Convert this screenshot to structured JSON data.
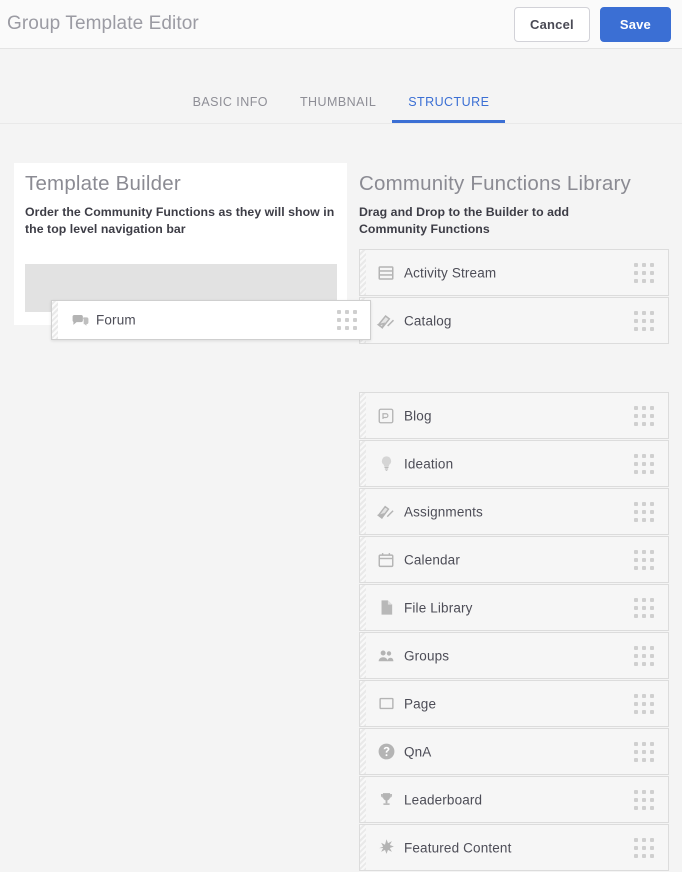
{
  "topbar": {
    "title": "Group Template Editor",
    "cancel_label": "Cancel",
    "save_label": "Save",
    "save_color": "#3b6fd4"
  },
  "tabs": [
    {
      "label": "BASIC INFO",
      "active": false
    },
    {
      "label": "THUMBNAIL",
      "active": false
    },
    {
      "label": "STRUCTURE",
      "active": true
    }
  ],
  "builder": {
    "title": "Template Builder",
    "subtitle": "Order the Community Functions as they will show in the top level navigation bar",
    "placeholder_visible": true
  },
  "library": {
    "title": "Community Functions Library",
    "subtitle": "Drag and Drop to the Builder to add Community Functions",
    "items": [
      {
        "label": "Activity Stream",
        "icon": "activity-stream-icon",
        "gap_after": false
      },
      {
        "label": "Catalog",
        "icon": "catalog-icon",
        "gap_after": true
      },
      {
        "label": "Blog",
        "icon": "blog-icon",
        "gap_after": false
      },
      {
        "label": "Ideation",
        "icon": "lightbulb-icon",
        "gap_after": false
      },
      {
        "label": "Assignments",
        "icon": "assignments-icon",
        "gap_after": false
      },
      {
        "label": "Calendar",
        "icon": "calendar-icon",
        "gap_after": false
      },
      {
        "label": "File Library",
        "icon": "file-icon",
        "gap_after": false
      },
      {
        "label": "Groups",
        "icon": "groups-icon",
        "gap_after": false
      },
      {
        "label": "Page",
        "icon": "page-icon",
        "gap_after": false
      },
      {
        "label": "QnA",
        "icon": "question-mark-icon",
        "gap_after": false
      },
      {
        "label": "Leaderboard",
        "icon": "trophy-icon",
        "gap_after": false
      },
      {
        "label": "Featured Content",
        "icon": "star-burst-icon",
        "gap_after": false
      }
    ]
  },
  "drag_card": {
    "label": "Forum",
    "icon": "forum-icon"
  }
}
